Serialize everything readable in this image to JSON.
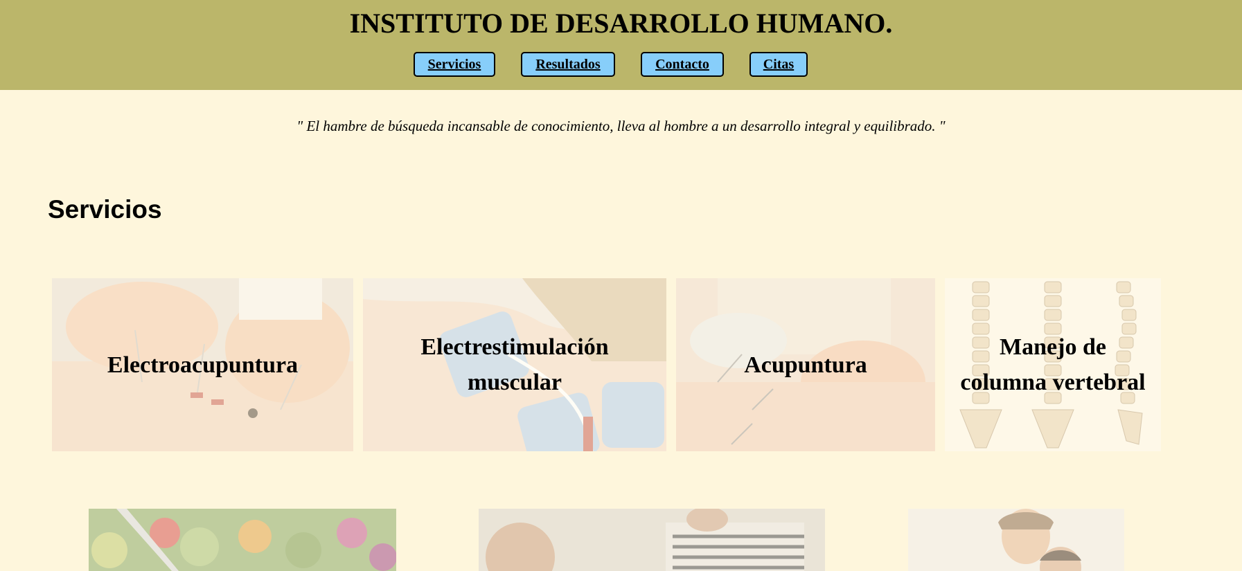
{
  "header": {
    "title": "INSTITUTO DE DESARROLLO HUMANO.",
    "nav": [
      {
        "label": "Servicios"
      },
      {
        "label": "Resultados"
      },
      {
        "label": "Contacto"
      },
      {
        "label": "Citas"
      }
    ]
  },
  "quote": "\" El hambre de búsqueda incansable de conocimiento, lleva al hombre a un desarrollo integral y equilibrado. \"",
  "services": {
    "title": "Servicios",
    "cards": [
      {
        "label": "Electroacupuntura"
      },
      {
        "label": "Electrestimulación muscular"
      },
      {
        "label": "Acupuntura"
      },
      {
        "label": "Manejo de columna vertebral"
      }
    ]
  },
  "colors": {
    "header_bg": "#bbb66a",
    "page_bg": "#fef6dc",
    "nav_button_bg": "#87cefa"
  }
}
